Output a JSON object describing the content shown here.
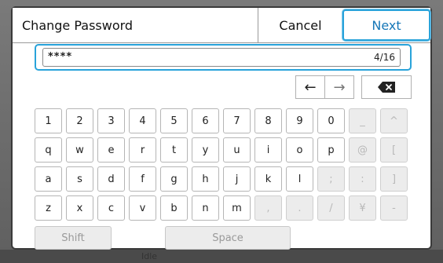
{
  "dialog": {
    "title": "Change Password",
    "cancel_label": "Cancel",
    "next_label": "Next"
  },
  "input": {
    "value": "****",
    "count": "4/16"
  },
  "nav": {
    "left_arrow": "←",
    "right_arrow": "→",
    "backspace_icon": "backspace-icon"
  },
  "keys": {
    "row1": [
      "1",
      "2",
      "3",
      "4",
      "5",
      "6",
      "7",
      "8",
      "9",
      "0",
      "_",
      "^"
    ],
    "row2": [
      "q",
      "w",
      "e",
      "r",
      "t",
      "y",
      "u",
      "i",
      "o",
      "p",
      "@",
      "["
    ],
    "row3": [
      "a",
      "s",
      "d",
      "f",
      "g",
      "h",
      "j",
      "k",
      "l",
      ";",
      ":",
      "]"
    ],
    "row4": [
      "z",
      "x",
      "c",
      "v",
      "b",
      "n",
      "m",
      ",",
      ".",
      "/",
      "¥",
      "-"
    ],
    "disabled": {
      "row1": [
        10,
        11
      ],
      "row2": [
        10,
        11
      ],
      "row3": [
        9,
        10,
        11
      ],
      "row4": [
        7,
        8,
        9,
        10,
        11
      ]
    },
    "shift_label": "Shift",
    "space_label": "Space"
  },
  "backdrop": {
    "bottom_text": "Idle"
  },
  "colors": {
    "accent": "#29a3da",
    "next_text": "#1677b8"
  }
}
